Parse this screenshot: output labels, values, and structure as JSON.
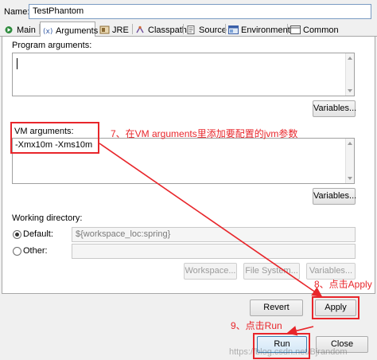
{
  "name": {
    "label": "Name:",
    "value": "TestPhantom"
  },
  "tabs": [
    {
      "label": "Main",
      "icon": "main-tab-icon"
    },
    {
      "label": "Arguments",
      "icon": "arguments-tab-icon",
      "active": true
    },
    {
      "label": "JRE",
      "icon": "jre-tab-icon"
    },
    {
      "label": "Classpath",
      "icon": "classpath-tab-icon"
    },
    {
      "label": "Source",
      "icon": "source-tab-icon"
    },
    {
      "label": "Environment",
      "icon": "environment-tab-icon"
    },
    {
      "label": "Common",
      "icon": "common-tab-icon"
    }
  ],
  "program_args": {
    "label": "Program arguments:",
    "value": "",
    "variables_label": "Variables..."
  },
  "vm_args": {
    "label": "VM arguments:",
    "value": "-Xmx10m -Xms10m",
    "variables_label": "Variables..."
  },
  "working_dir": {
    "label": "Working directory:",
    "default_label": "Default:",
    "default_value": "${workspace_loc:spring}",
    "other_label": "Other:",
    "other_value": "",
    "workspace_btn": "Workspace...",
    "filesystem_btn": "File System...",
    "variables_btn": "Variables..."
  },
  "buttons": {
    "revert": "Revert",
    "apply": "Apply",
    "run": "Run",
    "close": "Close"
  },
  "annotations": {
    "step7": "7、在VM arguments里添加要配置的jvm参数",
    "step8": "8、点击Apply",
    "step9": "9、点击Run"
  },
  "watermark": "https://blog.csdn.net/Bjrandom",
  "colors": {
    "annotation": "#e8262b",
    "active_tab": "#ffffff",
    "accent": "#3c7fb1"
  }
}
